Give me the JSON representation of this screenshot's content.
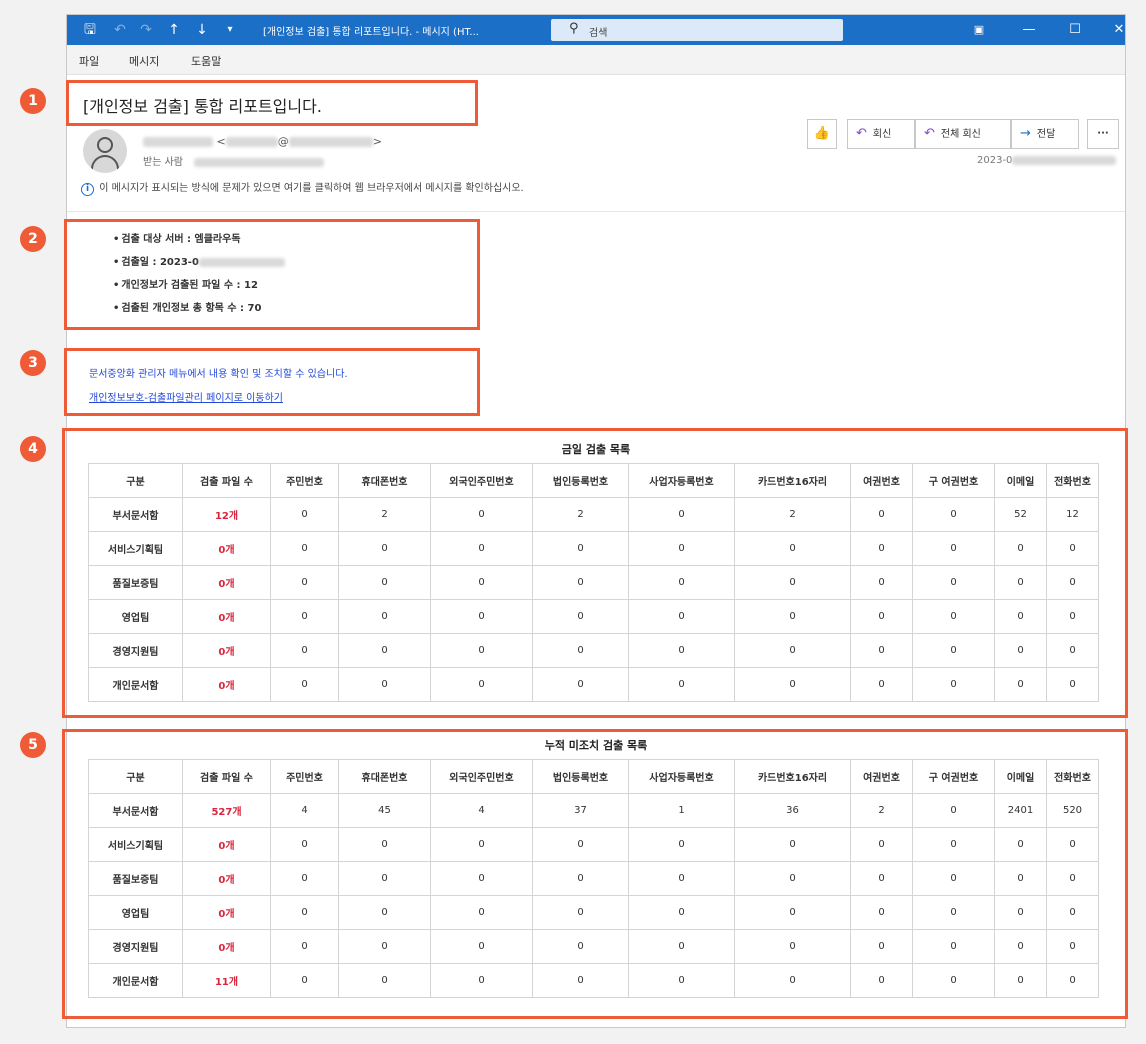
{
  "window": {
    "title": "[개인정보 검출] 통합 리포트입니다. - 메시지 (HT...",
    "search_placeholder": "검색"
  },
  "menu": [
    "파일",
    "메시지",
    "도움말"
  ],
  "message": {
    "subject": "[개인정보 검출] 통합 리포트입니다.",
    "sender_at": "@",
    "to_label": "받는 사람",
    "info_text": "이 메시지가 표시되는 방식에 문제가 있으면 여기를 클릭하여 웹 브라우저에서 메시지를 확인하십시오.",
    "date_prefix": "2023-0",
    "actions": {
      "reply": "회신",
      "reply_all": "전체 회신",
      "forward": "전달",
      "more": "···"
    }
  },
  "summary": {
    "items": [
      "검출 대상 서버 : 엠클라우독",
      "검출일 : 2023-0",
      "개인정보가 검출된 파일 수 : 12",
      "검출된 개인정보 총 항목 수 : 70"
    ]
  },
  "notice": {
    "text": "문서중앙화 관리자 메뉴에서 내용 확인 및 조치할 수 있습니다.",
    "link": "개인정보보호-검출파일관리 페이지로 이동하기"
  },
  "columns": [
    "구분",
    "검출 파일 수",
    "주민번호",
    "휴대폰번호",
    "외국인주민번호",
    "법인등록번호",
    "사업자등록번호",
    "카드번호16자리",
    "여권번호",
    "구 여권번호",
    "이메일",
    "전화번호"
  ],
  "today_table": {
    "title": "금일 검출 목록",
    "rows": [
      [
        "부서문서함",
        "12개",
        "0",
        "2",
        "0",
        "2",
        "0",
        "2",
        "0",
        "0",
        "52",
        "12"
      ],
      [
        "서비스기획팀",
        "0개",
        "0",
        "0",
        "0",
        "0",
        "0",
        "0",
        "0",
        "0",
        "0",
        "0"
      ],
      [
        "품질보증팀",
        "0개",
        "0",
        "0",
        "0",
        "0",
        "0",
        "0",
        "0",
        "0",
        "0",
        "0"
      ],
      [
        "영업팀",
        "0개",
        "0",
        "0",
        "0",
        "0",
        "0",
        "0",
        "0",
        "0",
        "0",
        "0"
      ],
      [
        "경영지원팀",
        "0개",
        "0",
        "0",
        "0",
        "0",
        "0",
        "0",
        "0",
        "0",
        "0",
        "0"
      ],
      [
        "개인문서함",
        "0개",
        "0",
        "0",
        "0",
        "0",
        "0",
        "0",
        "0",
        "0",
        "0",
        "0"
      ]
    ]
  },
  "cumulative_table": {
    "title": "누적 미조치 검출 목록",
    "rows": [
      [
        "부서문서함",
        "527개",
        "4",
        "45",
        "4",
        "37",
        "1",
        "36",
        "2",
        "0",
        "2401",
        "520"
      ],
      [
        "서비스기획팀",
        "0개",
        "0",
        "0",
        "0",
        "0",
        "0",
        "0",
        "0",
        "0",
        "0",
        "0"
      ],
      [
        "품질보증팀",
        "0개",
        "0",
        "0",
        "0",
        "0",
        "0",
        "0",
        "0",
        "0",
        "0",
        "0"
      ],
      [
        "영업팀",
        "0개",
        "0",
        "0",
        "0",
        "0",
        "0",
        "0",
        "0",
        "0",
        "0",
        "0"
      ],
      [
        "경영지원팀",
        "0개",
        "0",
        "0",
        "0",
        "0",
        "0",
        "0",
        "0",
        "0",
        "0",
        "0"
      ],
      [
        "개인문서함",
        "11개",
        "0",
        "0",
        "0",
        "0",
        "0",
        "0",
        "0",
        "0",
        "0",
        "0"
      ]
    ]
  },
  "annotations": [
    "1",
    "2",
    "3",
    "4",
    "5"
  ],
  "colors": {
    "titlebar": "#1b6fc7",
    "annotation": "#ef5b36",
    "link": "#2349d8",
    "file_count": "#d7263d"
  }
}
